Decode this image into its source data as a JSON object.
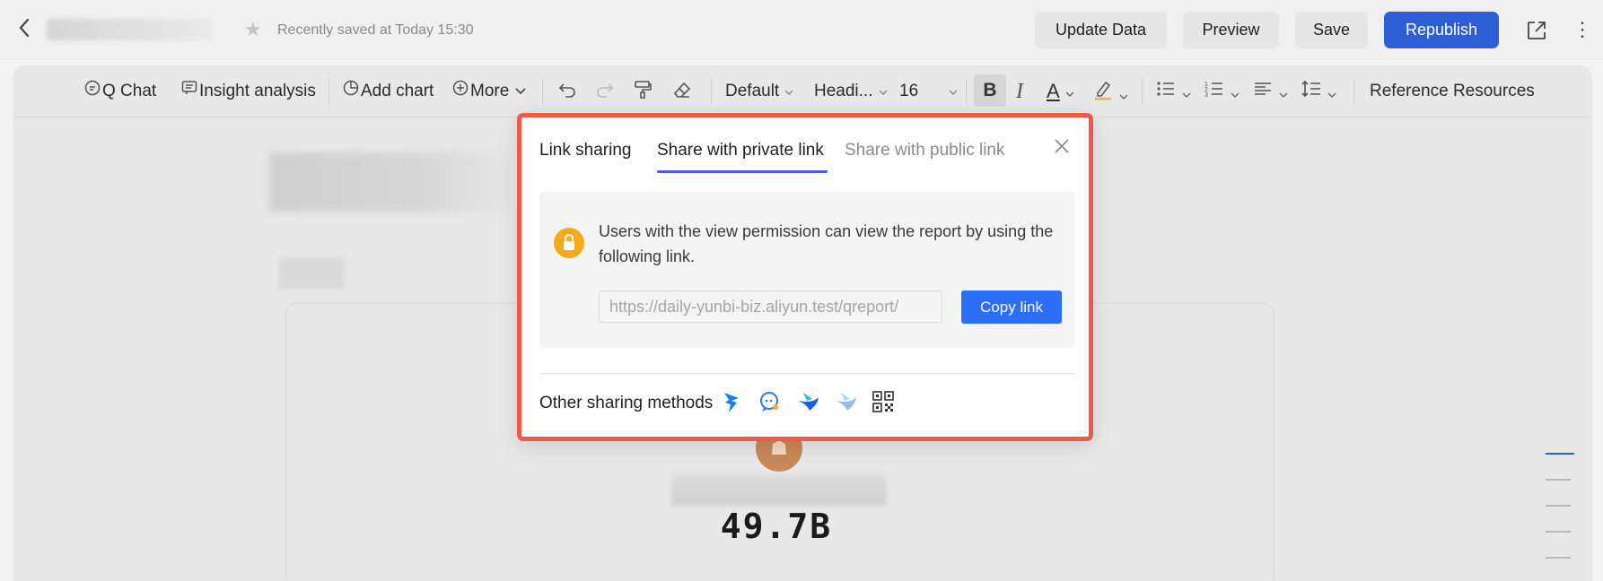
{
  "header": {
    "back_icon": "chevron-left-icon",
    "star_icon": "star-icon",
    "saved_status": "Recently saved at Today 15:30",
    "buttons": {
      "update": "Update Data",
      "preview": "Preview",
      "save": "Save",
      "republish": "Republish"
    },
    "accent_color": "#2c5fd5"
  },
  "toolbar": {
    "q_chat": "Q Chat",
    "insight": "Insight analysis",
    "add_chart": "Add chart",
    "more": "More",
    "font_default": "Default",
    "heading": "Headi...",
    "font_size": "16",
    "bold": "B",
    "italic": "I",
    "font_color": "A",
    "reference": "Reference Resources"
  },
  "content": {
    "value": "49.7B"
  },
  "dialog": {
    "tabs": [
      "Link sharing",
      "Share with private link",
      "Share with public link"
    ],
    "active_tab": "Share with private link",
    "info_text": "Users with the view permission can view the report by using the following link.",
    "link_value": "https://daily-yunbi-biz.aliyun.test/qreport/",
    "copy_button": "Copy link",
    "other_methods_label": "Other sharing methods",
    "share_icons": [
      "dingtalk-icon",
      "chat-bubble-icon",
      "bird-blue-icon",
      "bird-light-icon",
      "qr-code-icon"
    ],
    "highlight_color": "#ef5a48"
  }
}
